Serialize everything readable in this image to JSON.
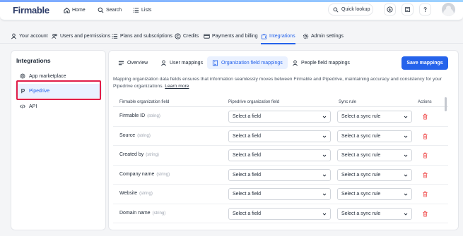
{
  "topbar": {
    "logo": "Firmable",
    "nav": [
      {
        "label": "Home",
        "icon": "home-icon"
      },
      {
        "label": "Search",
        "icon": "search-icon"
      },
      {
        "label": "Lists",
        "icon": "list-icon"
      }
    ],
    "quick_lookup": "Quick lookup",
    "icons": [
      "download-icon",
      "credits-icon",
      "help-icon"
    ]
  },
  "account_tabs": [
    {
      "label": "Your account",
      "icon": "user-icon"
    },
    {
      "label": "Users and permissions",
      "icon": "users-icon"
    },
    {
      "label": "Plans and subscriptions",
      "icon": "list-icon"
    },
    {
      "label": "Credits",
      "icon": "credits-icon"
    },
    {
      "label": "Payments and billing",
      "icon": "card-icon"
    },
    {
      "label": "Integrations",
      "icon": "puzzle-icon",
      "active": true
    },
    {
      "label": "Admin settings",
      "icon": "gear-icon"
    }
  ],
  "sidebar": {
    "title": "Integrations",
    "items": [
      {
        "label": "App marketplace",
        "icon": "marketplace-icon"
      },
      {
        "label": "Pipedrive",
        "icon": "pipedrive-icon",
        "active": true
      },
      {
        "label": "API",
        "icon": "code-icon"
      }
    ]
  },
  "main": {
    "subtabs": [
      {
        "label": "Overview",
        "icon": "menu-icon"
      },
      {
        "label": "User mappings",
        "icon": "user-icon"
      },
      {
        "label": "Organization field mappings",
        "icon": "building-icon",
        "active": true
      },
      {
        "label": "People field mappings",
        "icon": "user-icon"
      }
    ],
    "save_label": "Save mappings",
    "description": "Mapping organization data fields ensures that information seamlessly moves between Firmable and Pipedrive, maintaining accuracy and consistency for your Pipedrive organizations.",
    "learn_more": "Learn more",
    "table": {
      "headers": [
        "Firmable organization field",
        "Pipedrive organization field",
        "Sync rule",
        "Actions"
      ],
      "select_field_placeholder": "Select a field",
      "sync_rule_placeholder": "Select a sync rule",
      "rows": [
        {
          "name": "Firmable ID",
          "type": "(string)"
        },
        {
          "name": "Source",
          "type": "(string)"
        },
        {
          "name": "Created by",
          "type": "(string)"
        },
        {
          "name": "Company name",
          "type": "(string)"
        },
        {
          "name": "Website",
          "type": "(string)"
        },
        {
          "name": "Domain name",
          "type": "(string)"
        }
      ]
    }
  },
  "colors": {
    "accent": "#2563eb",
    "highlight": "#e11d48",
    "active_bg": "#eaf1ff"
  }
}
